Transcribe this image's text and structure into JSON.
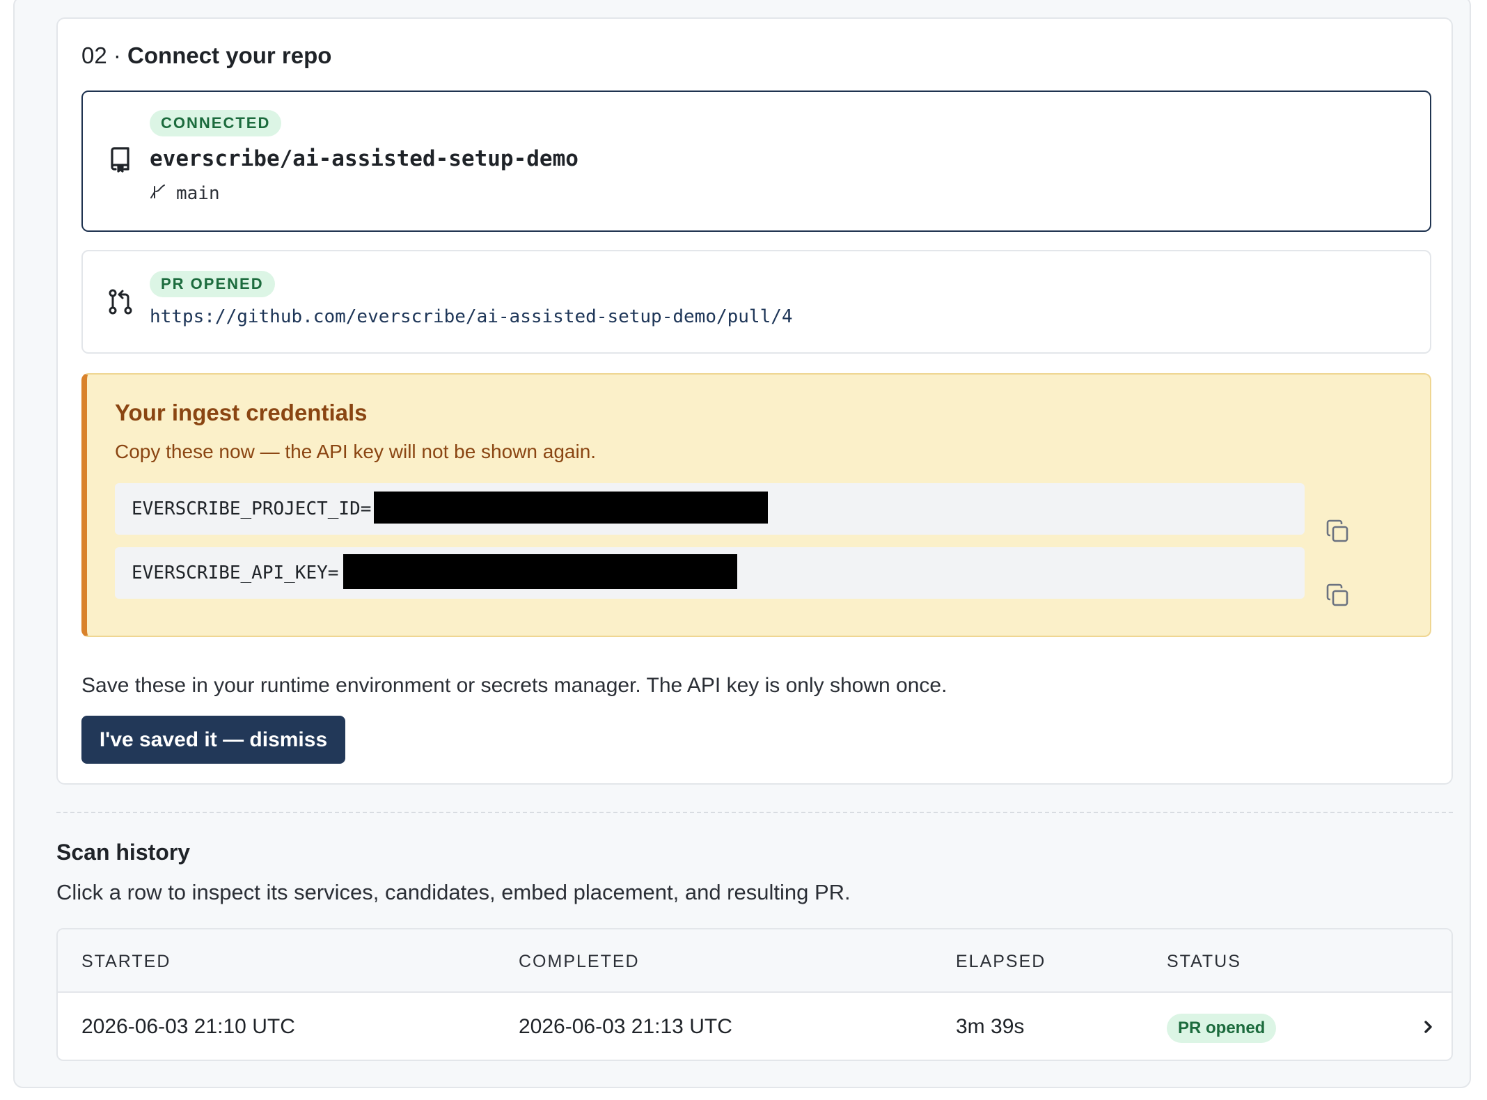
{
  "step": {
    "number": "02 ·",
    "title": "Connect your repo"
  },
  "repo": {
    "status_badge": "CONNECTED",
    "name": "everscribe/ai-assisted-setup-demo",
    "branch": "main",
    "icon": "repo-icon",
    "branch_icon": "branch-icon"
  },
  "pull_request": {
    "status_badge": "PR OPENED",
    "url": "https://github.com/everscribe/ai-assisted-setup-demo/pull/4",
    "icon": "pull-request-icon"
  },
  "credentials": {
    "title": "Your ingest credentials",
    "subtitle": "Copy these now — the API key will not be shown again.",
    "rows": [
      {
        "label": "EVERSCRIBE_PROJECT_ID=",
        "redacted": true,
        "copy_icon": "copy-icon"
      },
      {
        "label": "EVERSCRIBE_API_KEY=",
        "redacted": true,
        "copy_icon": "copy-icon"
      }
    ]
  },
  "save_note": "Save these in your runtime environment or secrets manager. The API key is only shown once.",
  "dismiss_button": "I've saved it — dismiss",
  "scan_history": {
    "title": "Scan history",
    "subtitle": "Click a row to inspect its services, candidates, embed placement, and resulting PR.",
    "columns": [
      "STARTED",
      "COMPLETED",
      "ELAPSED",
      "STATUS"
    ],
    "rows": [
      {
        "started": "2026-06-03 21:10 UTC",
        "completed": "2026-06-03 21:13 UTC",
        "elapsed": "3m 39s",
        "status": "PR opened"
      }
    ]
  },
  "colors": {
    "primary_button": "#223858",
    "badge_green_bg": "#dcf5e5",
    "badge_green_text": "#1c6b3d",
    "warning_bg": "#fbf0c9",
    "warning_accent": "#d9822b",
    "warning_text": "#8a4512"
  }
}
